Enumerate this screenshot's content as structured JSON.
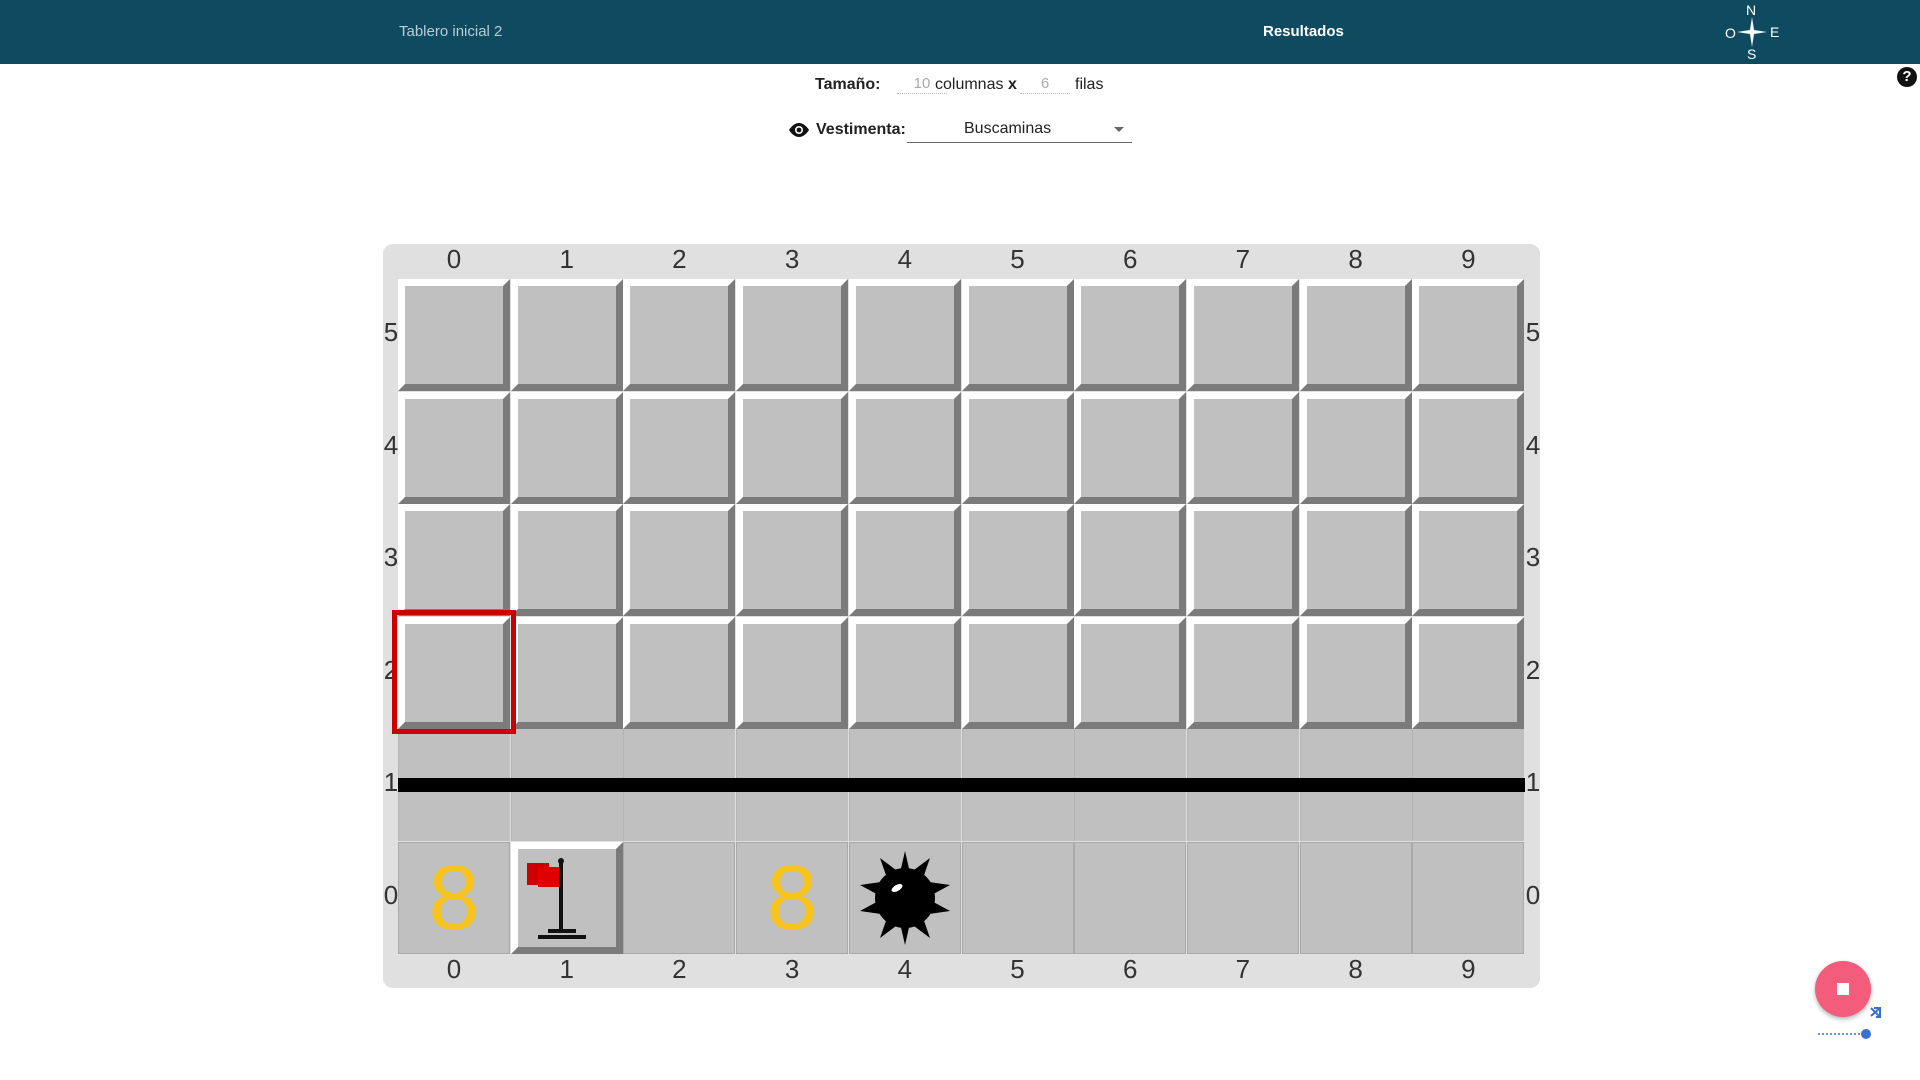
{
  "header": {
    "left_title": "Tablero inicial 2",
    "center_title": "Resultados",
    "compass": {
      "n": "N",
      "s": "S",
      "o": "O",
      "e": "E"
    }
  },
  "help_icon": "?",
  "size": {
    "label": "Tamaño:",
    "columns_value": "10",
    "columns_text": "columnas",
    "x_text": "x",
    "rows_value": "6",
    "rows_text": "filas"
  },
  "vestimenta": {
    "label": "Vestimenta:",
    "selected": "Buscaminas",
    "icon": "eye-icon"
  },
  "board": {
    "columns": [
      "0",
      "1",
      "2",
      "3",
      "4",
      "5",
      "6",
      "7",
      "8",
      "9"
    ],
    "rows_top_to_bottom": [
      "5",
      "4",
      "3",
      "2",
      "1",
      "0"
    ],
    "row0_cells": [
      {
        "col": "0",
        "content": "8"
      },
      {
        "col": "1",
        "content": "flag-icon"
      },
      {
        "col": "2",
        "content": ""
      },
      {
        "col": "3",
        "content": "8"
      },
      {
        "col": "4",
        "content": "mine-icon"
      },
      {
        "col": "5",
        "content": ""
      },
      {
        "col": "6",
        "content": ""
      },
      {
        "col": "7",
        "content": ""
      },
      {
        "col": "8",
        "content": ""
      },
      {
        "col": "9",
        "content": ""
      }
    ],
    "selected_cell": {
      "col": "0",
      "row": "2"
    },
    "wall_row": "1",
    "colors": {
      "cell": "#c0c0c0",
      "digit": "#f7c41d",
      "selector": "#cc0000",
      "header": "#0e4a60",
      "stop_button": "#f35c7a"
    }
  },
  "controls": {
    "stop_button": "stop-icon",
    "speed_slider": "shuffle-icon"
  }
}
